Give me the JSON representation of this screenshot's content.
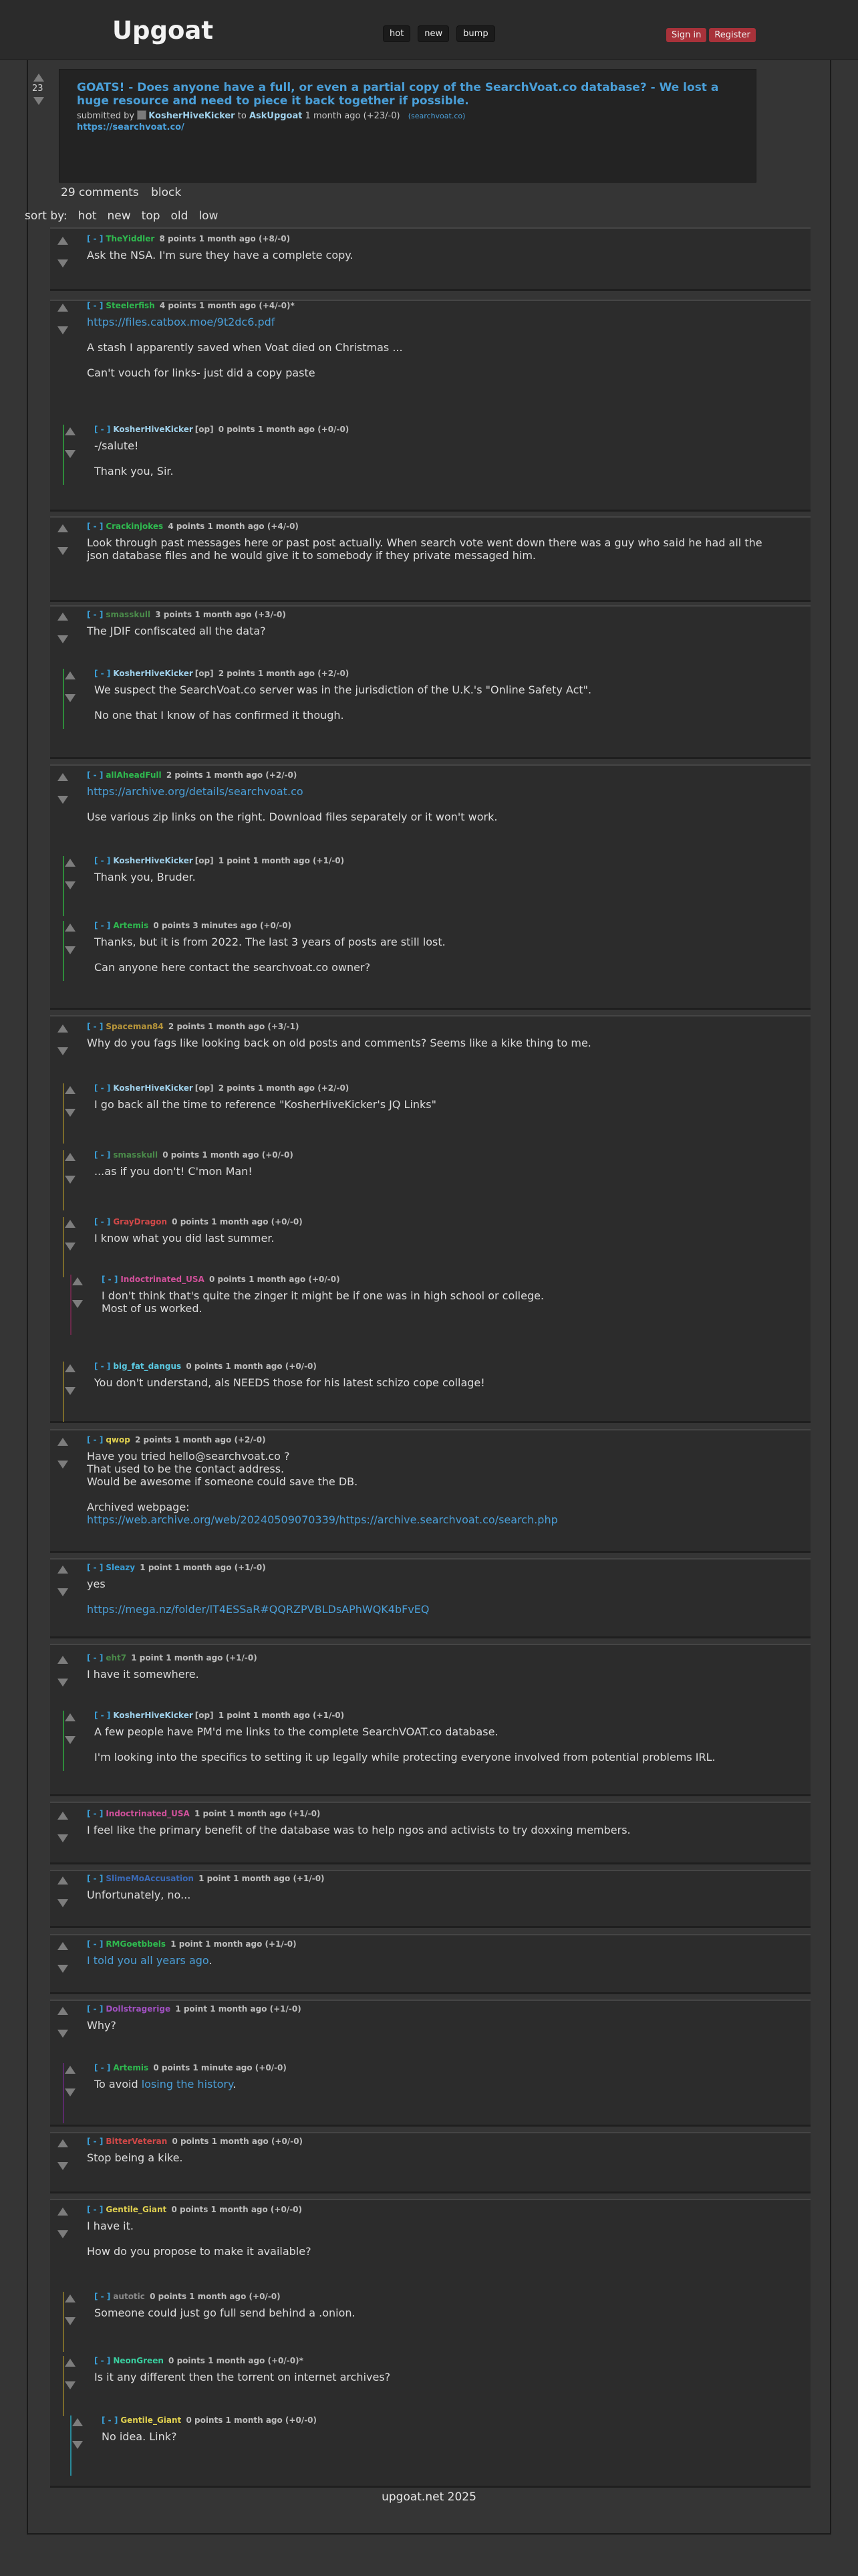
{
  "header": {
    "logo": "Upgoat",
    "nav": [
      "hot",
      "new",
      "bump"
    ],
    "auth": [
      "Sign in",
      "Register"
    ]
  },
  "post": {
    "score": "23",
    "title": "GOATS! - Does anyone have a full, or even a partial copy of the SearchVoat.co database? - We lost a huge resource and need to piece it back together if possible.",
    "submitted_prefix": "submitted by",
    "author": "KosherHiveKicker",
    "to": "to",
    "sub": "AskUpgoat",
    "age": "1 month ago (+23/-0)",
    "domain": "(searchvoat.co)",
    "link": "https://searchvoat.co/"
  },
  "comments_count": "29 comments",
  "block": "block",
  "sort": {
    "label": "sort by:",
    "options": [
      "hot",
      "new",
      "top",
      "old",
      "low"
    ]
  },
  "comments": [
    {
      "toggle": "[ - ]",
      "user": "TheYiddler",
      "points": "8 points 1 month ago (+8/-0)",
      "text": "Ask the NSA. I'm sure they have a complete copy.",
      "ucolor": "#2fb94f"
    },
    {
      "toggle": "[ - ]",
      "user": "Steelerfish",
      "points": "4 points 1 month ago (+4/-0)*",
      "link": "https://files.catbox.moe/9t2dc6.pdf",
      "text": "A stash I apparently saved when Voat died on Christmas ...\n\nCan't vouch for links- just did a copy paste",
      "ucolor": "#2fb94f"
    },
    {
      "toggle": "[ - ]",
      "user": "KosherHiveKicker",
      "op": "[op]",
      "points": "0 points 1 month ago (+0/-0)",
      "text": "-/salute!\n\nThank you, Sir.",
      "ucolor": "#9fd0ea"
    },
    {
      "toggle": "[ - ]",
      "user": "Crackinjokes",
      "points": "4 points 1 month ago (+4/-0)",
      "text": "Look through past messages here or past post actually. When search vote went down there was a guy who said he had all the json database files and he would give it to somebody if they private messaged him.",
      "ucolor": "#2fb94f"
    },
    {
      "toggle": "[ - ]",
      "user": "smasskull",
      "points": "3 points 1 month ago (+3/-0)",
      "text": "The JDIF confiscated all the data?",
      "ucolor": "#4a8a4a"
    },
    {
      "toggle": "[ - ]",
      "user": "KosherHiveKicker",
      "op": "[op]",
      "points": "2 points 1 month ago (+2/-0)",
      "text": "We suspect the SearchVoat.co server was in the jurisdiction of the U.K.'s \"Online Safety Act\".\n\nNo one that I know of has confirmed it though.",
      "ucolor": "#9fd0ea"
    },
    {
      "toggle": "[ - ]",
      "user": "allAheadFull",
      "points": "2 points 1 month ago (+2/-0)",
      "link": "https://archive.org/details/searchvoat.co",
      "text": "Use various zip links on the right. Download files separately or it won't work.",
      "ucolor": "#2fb94f"
    },
    {
      "toggle": "[ - ]",
      "user": "KosherHiveKicker",
      "op": "[op]",
      "points": "1 point 1 month ago (+1/-0)",
      "text": "Thank you, Bruder.",
      "ucolor": "#9fd0ea"
    },
    {
      "toggle": "[ - ]",
      "user": "Artemis",
      "points": "0 points 3 minutes ago (+0/-0)",
      "text": "Thanks, but it is from 2022. The last 3 years of posts are still lost.\n\nCan anyone here contact the searchvoat.co owner?",
      "ucolor": "#2fb94f"
    },
    {
      "toggle": "[ - ]",
      "user": "Spaceman84",
      "points": "2 points 1 month ago (+3/-1)",
      "text": "Why do you fags like looking back on old posts and comments? Seems like a kike thing to me.",
      "ucolor": "#b8963a"
    },
    {
      "toggle": "[ - ]",
      "user": "KosherHiveKicker",
      "op": "[op]",
      "points": "2 points 1 month ago (+2/-0)",
      "text": "I go back all the time to reference \"KosherHiveKicker's JQ Links\"",
      "ucolor": "#9fd0ea"
    },
    {
      "toggle": "[ - ]",
      "user": "smasskull",
      "points": "0 points 1 month ago (+0/-0)",
      "text": "...as if you don't! C'mon Man!",
      "ucolor": "#4a8a4a"
    },
    {
      "toggle": "[ - ]",
      "user": "GrayDragon",
      "points": "0 points 1 month ago (+0/-0)",
      "text": "I know what you did last summer.",
      "ucolor": "#d04848"
    },
    {
      "toggle": "[ - ]",
      "user": "Indoctrinated_USA",
      "points": "0 points 1 month ago (+0/-0)",
      "text": "I don't think that's quite the zinger it might be if one was in high school or college.\nMost of us worked.",
      "ucolor": "#d0509a"
    },
    {
      "toggle": "[ - ]",
      "user": "big_fat_dangus",
      "points": "0 points 1 month ago (+0/-0)",
      "text": "You don't understand, als NEEDS those for his latest schizo cope collage!",
      "ucolor": "#5ac8e0"
    },
    {
      "toggle": "[ - ]",
      "user": "qwop",
      "points": "2 points 1 month ago (+2/-0)",
      "text": "Have you tried hello@searchvoat.co ?\nThat used to be the contact address.\nWould be awesome if someone could save the DB.\n\nArchived webpage:",
      "link2": "https://web.archive.org/web/20240509070339/https://archive.searchvoat.co/search.php",
      "ucolor": "#e0d050"
    },
    {
      "toggle": "[ - ]",
      "user": "Sleazy",
      "points": "1 point 1 month ago (+1/-0)",
      "text": "yes",
      "link2": "https://mega.nz/folder/lT4ESSaR#QQRZPVBLDsAPhWQK4bFvEQ",
      "ucolor": "#3aa0d8"
    },
    {
      "toggle": "[ - ]",
      "user": "eht7",
      "points": "1 point 1 month ago (+1/-0)",
      "text": "I have it somewhere.",
      "ucolor": "#4a8a4a"
    },
    {
      "toggle": "[ - ]",
      "user": "KosherHiveKicker",
      "op": "[op]",
      "points": "1 point 1 month ago (+1/-0)",
      "text": "A few people have PM'd me links to the complete SearchVOAT.co database.\n\nI'm looking into the specifics to setting it up legally while protecting everyone involved from potential problems IRL.",
      "ucolor": "#9fd0ea"
    },
    {
      "toggle": "[ - ]",
      "user": "Indoctrinated_USA",
      "points": "1 point 1 month ago (+1/-0)",
      "text": "I feel like the primary benefit of the database was to help ngos and activists to try doxxing members.",
      "ucolor": "#d0509a"
    },
    {
      "toggle": "[ - ]",
      "user": "SlimeMoAccusation",
      "points": "1 point 1 month ago (+1/-0)",
      "text": "Unfortunately, no...",
      "ucolor": "#3a6ab8"
    },
    {
      "toggle": "[ - ]",
      "user": "RMGoetbbels",
      "points": "1 point 1 month ago (+1/-0)",
      "link3": "I told you all years ago",
      "ucolor": "#2fb94f"
    },
    {
      "toggle": "[ - ]",
      "user": "Dollstragerige",
      "points": "1 point 1 month ago (+1/-0)",
      "text": "Why?",
      "ucolor": "#a050c0"
    },
    {
      "toggle": "[ - ]",
      "user": "Artemis",
      "points": "0 points 1 minute ago (+0/-0)",
      "textpre": "To avoid ",
      "link3": "losing the history",
      "textpost": ".",
      "ucolor": "#2fb94f"
    },
    {
      "toggle": "[ - ]",
      "user": "BitterVeteran",
      "points": "0 points 1 month ago (+0/-0)",
      "text": "Stop being a kike.",
      "ucolor": "#d04848"
    },
    {
      "toggle": "[ - ]",
      "user": "Gentile_Giant",
      "points": "0 points 1 month ago (+0/-0)",
      "text": "I have it.\n\nHow do you propose to make it available?",
      "ucolor": "#e0d050"
    },
    {
      "toggle": "[ - ]",
      "user": "autotic",
      "points": "0 points 1 month ago (+0/-0)",
      "text": "Someone could just go full send behind a .onion.",
      "ucolor": "#8a8a8a"
    },
    {
      "toggle": "[ - ]",
      "user": "NeonGreen",
      "points": "0 points 1 month ago (+0/-0)*",
      "text": "Is it any different then the torrent on internet archives?",
      "ucolor": "#3ad0a0"
    },
    {
      "toggle": "[ - ]",
      "user": "Gentile_Giant",
      "points": "0 points 1 month ago (+0/-0)",
      "text": "No idea. Link?",
      "ucolor": "#e0d050"
    }
  ],
  "footer": "upgoat.net 2025"
}
